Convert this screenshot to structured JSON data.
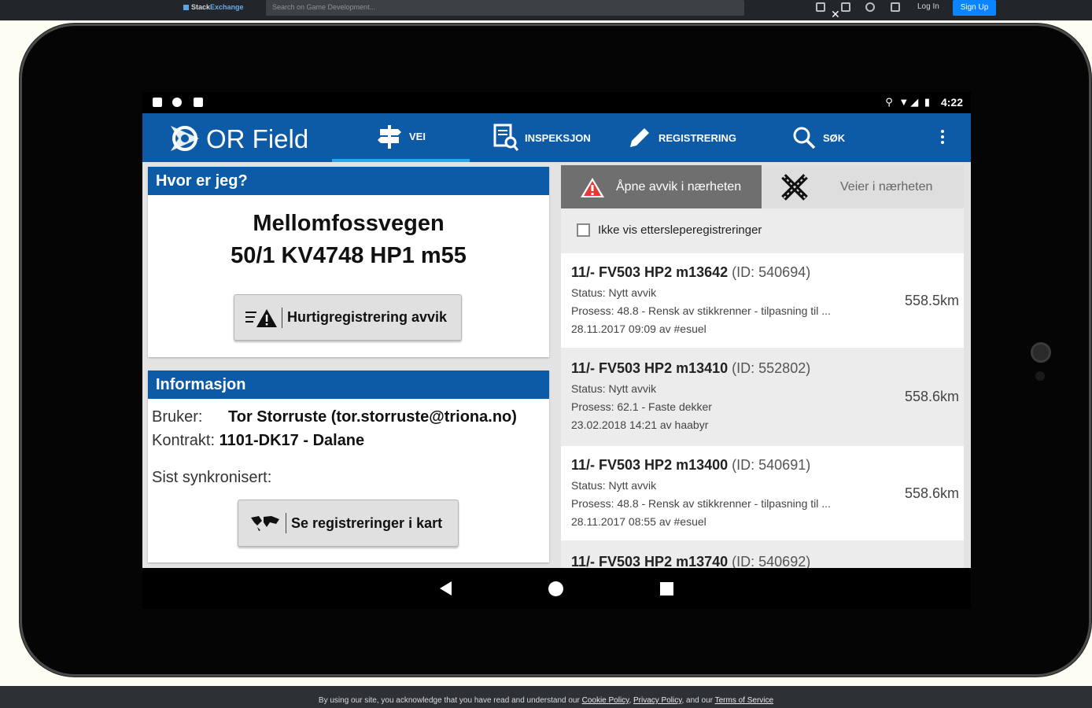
{
  "browser": {
    "logo_text_a": "Stack",
    "logo_text_b": "Exchange",
    "search_placeholder": "Search on Game Development...",
    "login": "Log In",
    "signup": "Sign Up"
  },
  "device": {
    "status_time": "4:22"
  },
  "app": {
    "title": "OR Field",
    "tabs": [
      {
        "label": "VEI",
        "active": true
      },
      {
        "label": "INSPEKSJON"
      },
      {
        "label": "REGISTRERING"
      },
      {
        "label": "SØK"
      }
    ]
  },
  "location": {
    "header": "Hvor er jeg?",
    "street": "Mellomfossvegen",
    "reference": "50/1 KV4748  HP1 m55",
    "quick_button": "Hurtigregistrering avvik"
  },
  "info": {
    "header": "Informasjon",
    "user_label": "Bruker:",
    "user_value": "Tor Storruste (tor.storruste@triona.no)",
    "contract_label": "Kontrakt:",
    "contract_value": "1101-DK17 - Dalane",
    "sync_label": "Sist synkronisert:",
    "map_button": "Se registreringer i kart"
  },
  "nearby": {
    "tab_open": "Åpne avvik i nærheten",
    "tab_roads": "Veier i nærheten",
    "checkbox_label": "Ikke vis ettersleperegistreringer",
    "items": [
      {
        "title": "11/- FV503 HP2 m13642",
        "id": "(ID: 540694)",
        "status": "Status:  Nytt avvik",
        "process": "Prosess: 48.8 - Rensk av stikkrenner - tilpasning til ...",
        "meta": "28.11.2017 09:09 av #esuel",
        "distance": "558.5km"
      },
      {
        "title": "11/- FV503 HP2 m13410",
        "id": "(ID: 552802)",
        "status": "Status:  Nytt avvik",
        "process": "Prosess: 62.1 - Faste dekker",
        "meta": "23.02.2018 14:21 av haabyr",
        "distance": "558.6km"
      },
      {
        "title": "11/- FV503 HP2 m13400",
        "id": "(ID: 540691)",
        "status": "Status:  Nytt avvik",
        "process": "Prosess: 48.8 - Rensk av stikkrenner - tilpasning til ...",
        "meta": "28.11.2017 08:55 av #esuel",
        "distance": "558.6km"
      },
      {
        "title": "11/- FV503 HP2 m13740",
        "id": "(ID: 540692)",
        "status": "",
        "process": "",
        "meta": "",
        "distance": ""
      }
    ]
  },
  "cookie": {
    "text_a": "By using our site, you acknowledge that you have read and understand our",
    "link_cookie": "Cookie Policy",
    "link_privacy": "Privacy Policy",
    "text_and": ", and our",
    "link_terms": "Terms of Service",
    "close": "✕"
  },
  "colors": {
    "brand_blue": "#0d5ba6",
    "tab_indicator": "#29a7e8",
    "warning_red": "#e53935"
  }
}
